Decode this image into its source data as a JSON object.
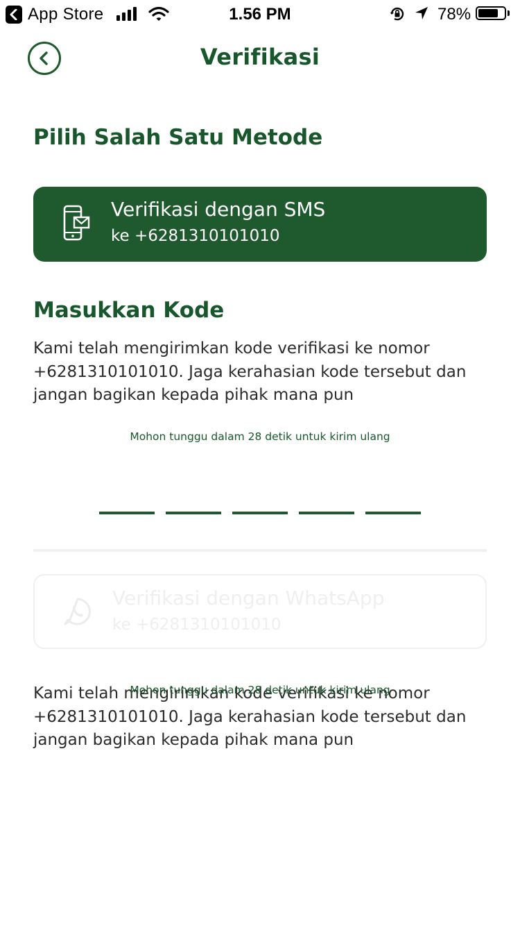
{
  "status_bar": {
    "back_app": "App Store",
    "time": "1.56 PM",
    "battery_pct": "78%",
    "battery_level": 0.78,
    "signal_bars": 4,
    "icons": [
      "back-arrow-icon",
      "signal-icon",
      "wifi-icon",
      "rotation-lock-icon",
      "location-arrow-icon",
      "battery-icon"
    ]
  },
  "header": {
    "title": "Verifikasi",
    "back_icon": "chevron-left-icon"
  },
  "choose_method": {
    "title": "Pilih Salah Satu Metode"
  },
  "sms_option": {
    "title": "Verifikasi dengan SMS",
    "subtitle": "ke +6281310101010",
    "icon": "phone-message-icon",
    "state": "selected"
  },
  "enter_code": {
    "title": "Masukkan Kode",
    "description": "Kami telah mengirimkan kode verifikasi ke nomor +6281310101010. Jaga kerahasian kode tersebut dan jangan bagikan kepada pihak mana pun",
    "resend_text": "Mohon tunggu dalam 28 detik untuk kirim ulang",
    "otp_length": 5,
    "otp_value": ""
  },
  "whatsapp_option": {
    "title": "Verifikasi dengan WhatsApp",
    "subtitle": "ke +6281310101010",
    "icon": "whatsapp-icon",
    "state": "inactive",
    "description": "Kami telah mengirimkan kode verifikasi ke nomor +6281310101010. Jaga kerahasian kode tersebut dan jangan bagikan kepada pihak mana pun",
    "resend_text": "Mohon tunggu dalam 28 detik untuk kirim ulang"
  },
  "colors": {
    "brand_green": "#17572b",
    "card_green": "#1f5a2e",
    "disabled_text": "#efefef",
    "divider": "#f0f0f0"
  }
}
